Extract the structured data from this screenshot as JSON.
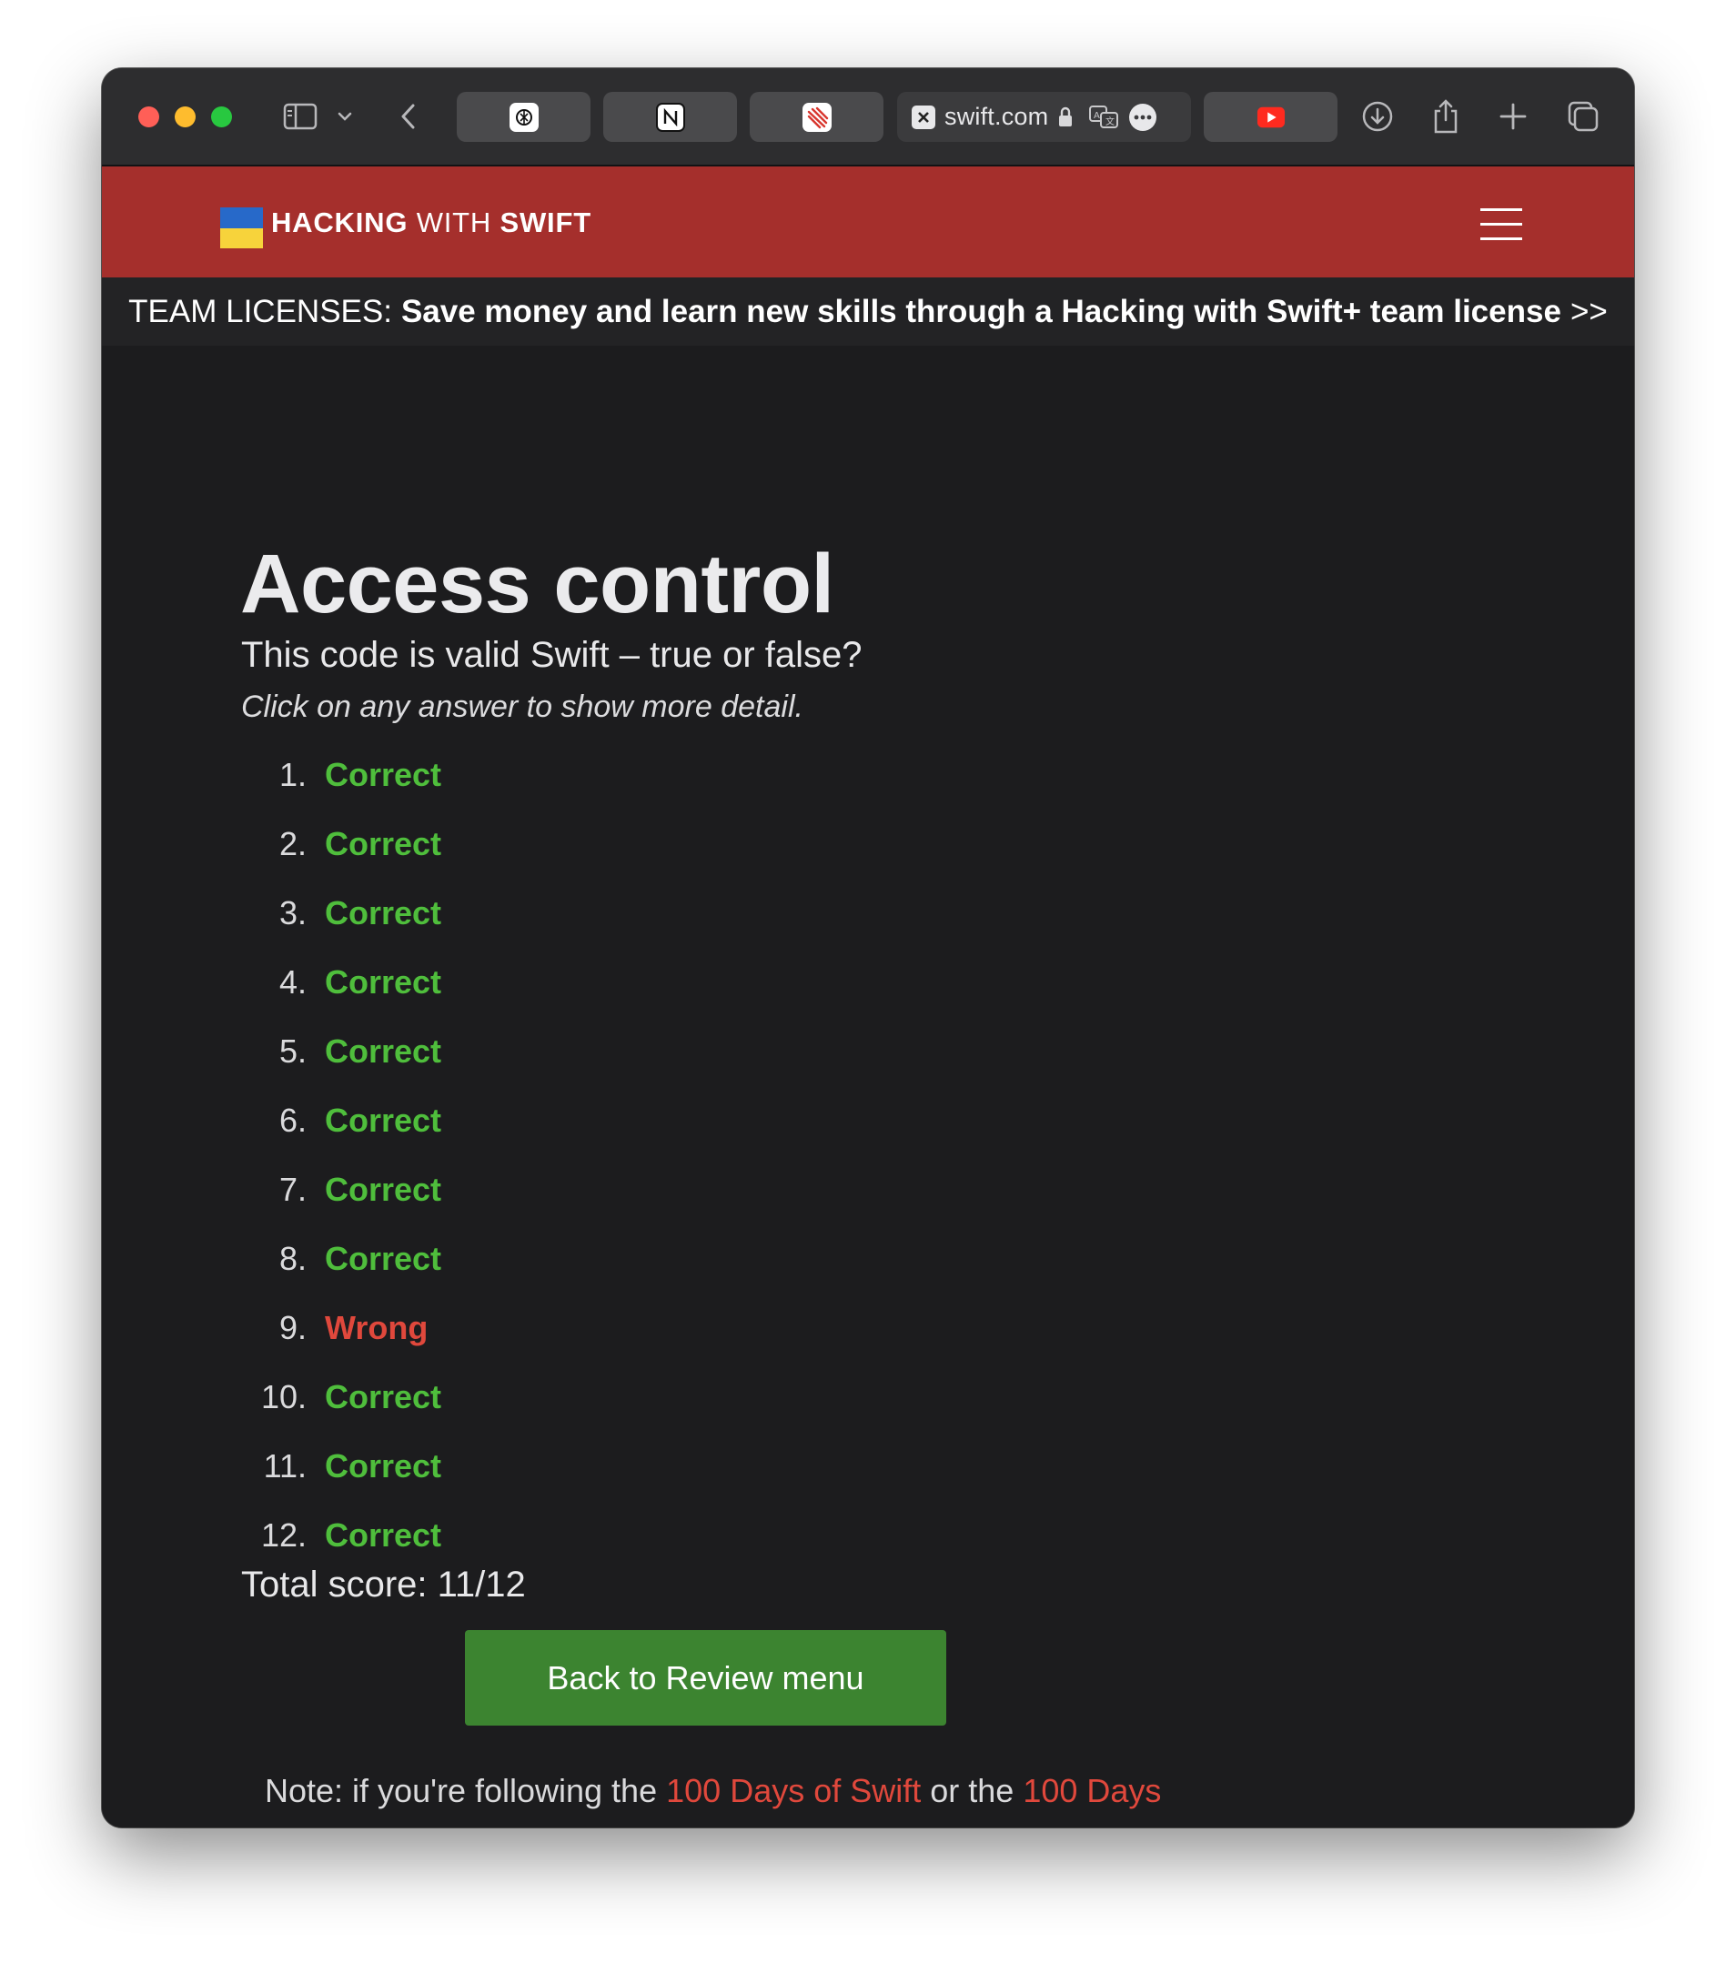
{
  "browser": {
    "tabs": [
      {
        "icon": "chatgpt-icon"
      },
      {
        "icon": "notion-icon"
      },
      {
        "icon": "red-app-icon"
      },
      {
        "icon": "x-icon",
        "url": "swift.com",
        "active": true
      },
      {
        "icon": "youtube-icon"
      }
    ]
  },
  "site": {
    "brand_bold_1": "HACKING",
    "brand_mid": "WITH",
    "brand_bold_2": "SWIFT",
    "brand_colors": {
      "header": "#a52f2c",
      "flag_blue": "#2769c9",
      "flag_yellow": "#f7d33b"
    }
  },
  "banner": {
    "prefix": "TEAM LICENSES:",
    "bold": "Save money and learn new skills through a Hacking with Swift+ team license",
    "suffix": ">>"
  },
  "main": {
    "title": "Access control",
    "subtitle": "This code is valid Swift – true or false?",
    "hint": "Click on any answer to show more detail.",
    "answers": [
      {
        "num": "1.",
        "result": "Correct"
      },
      {
        "num": "2.",
        "result": "Correct"
      },
      {
        "num": "3.",
        "result": "Correct"
      },
      {
        "num": "4.",
        "result": "Correct"
      },
      {
        "num": "5.",
        "result": "Correct"
      },
      {
        "num": "6.",
        "result": "Correct"
      },
      {
        "num": "7.",
        "result": "Correct"
      },
      {
        "num": "8.",
        "result": "Correct"
      },
      {
        "num": "9.",
        "result": "Wrong"
      },
      {
        "num": "10.",
        "result": "Correct"
      },
      {
        "num": "11.",
        "result": "Correct"
      },
      {
        "num": "12.",
        "result": "Correct"
      }
    ],
    "score": "Total score: 11/12",
    "back_button": "Back to Review menu",
    "note_prefix": "Note: if you're following the",
    "note_link_1": "100 Days of Swift",
    "note_mid": "or the",
    "note_link_2": "100 Days"
  },
  "colors": {
    "correct": "#4fbe3c",
    "wrong": "#e0483c",
    "button": "#3c8430"
  }
}
